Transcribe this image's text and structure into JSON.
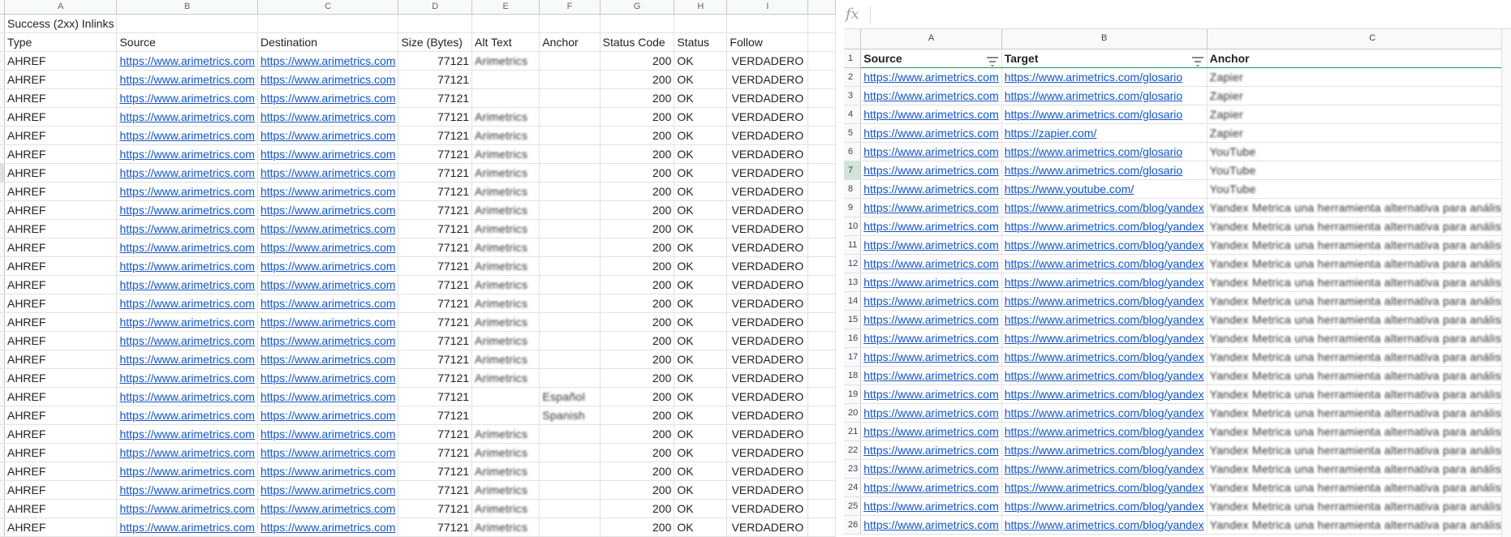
{
  "left": {
    "col_letters": [
      "A",
      "B",
      "C",
      "D",
      "E",
      "F",
      "G",
      "H",
      "I"
    ],
    "title": "Success (2xx) Inlinks",
    "headers": [
      "Type",
      "Source",
      "Destination",
      "Size (Bytes)",
      "Alt Text",
      "Anchor",
      "Status Code",
      "Status",
      "Follow"
    ],
    "rows": [
      [
        "AHREF",
        "https://www.arimetrics.com",
        "https://www.arimetrics.com",
        "77121",
        "Arimetrics",
        "",
        "200",
        "OK",
        "VERDADERO"
      ],
      [
        "AHREF",
        "https://www.arimetrics.com",
        "https://www.arimetrics.com",
        "77121",
        "",
        "",
        "200",
        "OK",
        "VERDADERO"
      ],
      [
        "AHREF",
        "https://www.arimetrics.com",
        "https://www.arimetrics.com",
        "77121",
        "",
        "",
        "200",
        "OK",
        "VERDADERO"
      ],
      [
        "AHREF",
        "https://www.arimetrics.com",
        "https://www.arimetrics.com",
        "77121",
        "Arimetrics",
        "",
        "200",
        "OK",
        "VERDADERO"
      ],
      [
        "AHREF",
        "https://www.arimetrics.com",
        "https://www.arimetrics.com",
        "77121",
        "Arimetrics",
        "",
        "200",
        "OK",
        "VERDADERO"
      ],
      [
        "AHREF",
        "https://www.arimetrics.com",
        "https://www.arimetrics.com",
        "77121",
        "Arimetrics",
        "",
        "200",
        "OK",
        "VERDADERO"
      ],
      [
        "AHREF",
        "https://www.arimetrics.com",
        "https://www.arimetrics.com",
        "77121",
        "Arimetrics",
        "",
        "200",
        "OK",
        "VERDADERO"
      ],
      [
        "AHREF",
        "https://www.arimetrics.com",
        "https://www.arimetrics.com",
        "77121",
        "Arimetrics",
        "",
        "200",
        "OK",
        "VERDADERO"
      ],
      [
        "AHREF",
        "https://www.arimetrics.com",
        "https://www.arimetrics.com",
        "77121",
        "Arimetrics",
        "",
        "200",
        "OK",
        "VERDADERO"
      ],
      [
        "AHREF",
        "https://www.arimetrics.com",
        "https://www.arimetrics.com",
        "77121",
        "Arimetrics",
        "",
        "200",
        "OK",
        "VERDADERO"
      ],
      [
        "AHREF",
        "https://www.arimetrics.com",
        "https://www.arimetrics.com",
        "77121",
        "Arimetrics",
        "",
        "200",
        "OK",
        "VERDADERO"
      ],
      [
        "AHREF",
        "https://www.arimetrics.com",
        "https://www.arimetrics.com",
        "77121",
        "Arimetrics",
        "",
        "200",
        "OK",
        "VERDADERO"
      ],
      [
        "AHREF",
        "https://www.arimetrics.com",
        "https://www.arimetrics.com",
        "77121",
        "Arimetrics",
        "",
        "200",
        "OK",
        "VERDADERO"
      ],
      [
        "AHREF",
        "https://www.arimetrics.com",
        "https://www.arimetrics.com",
        "77121",
        "Arimetrics",
        "",
        "200",
        "OK",
        "VERDADERO"
      ],
      [
        "AHREF",
        "https://www.arimetrics.com",
        "https://www.arimetrics.com",
        "77121",
        "Arimetrics",
        "",
        "200",
        "OK",
        "VERDADERO"
      ],
      [
        "AHREF",
        "https://www.arimetrics.com",
        "https://www.arimetrics.com",
        "77121",
        "Arimetrics",
        "",
        "200",
        "OK",
        "VERDADERO"
      ],
      [
        "AHREF",
        "https://www.arimetrics.com",
        "https://www.arimetrics.com",
        "77121",
        "Arimetrics",
        "",
        "200",
        "OK",
        "VERDADERO"
      ],
      [
        "AHREF",
        "https://www.arimetrics.com",
        "https://www.arimetrics.com",
        "77121",
        "Arimetrics",
        "",
        "200",
        "OK",
        "VERDADERO"
      ],
      [
        "AHREF",
        "https://www.arimetrics.com",
        "https://www.arimetrics.com",
        "77121",
        "",
        "Español",
        "200",
        "OK",
        "VERDADERO"
      ],
      [
        "AHREF",
        "https://www.arimetrics.com",
        "https://www.arimetrics.com",
        "77121",
        "",
        "Spanish",
        "200",
        "OK",
        "VERDADERO"
      ],
      [
        "AHREF",
        "https://www.arimetrics.com",
        "https://www.arimetrics.com",
        "77121",
        "Arimetrics",
        "",
        "200",
        "OK",
        "VERDADERO"
      ],
      [
        "AHREF",
        "https://www.arimetrics.com",
        "https://www.arimetrics.com",
        "77121",
        "Arimetrics",
        "",
        "200",
        "OK",
        "VERDADERO"
      ],
      [
        "AHREF",
        "https://www.arimetrics.com",
        "https://www.arimetrics.com",
        "77121",
        "Arimetrics",
        "",
        "200",
        "OK",
        "VERDADERO"
      ],
      [
        "AHREF",
        "https://www.arimetrics.com",
        "https://www.arimetrics.com",
        "77121",
        "Arimetrics",
        "",
        "200",
        "OK",
        "VERDADERO"
      ],
      [
        "AHREF",
        "https://www.arimetrics.com",
        "https://www.arimetrics.com",
        "77121",
        "Arimetrics",
        "",
        "200",
        "OK",
        "VERDADERO"
      ],
      [
        "AHREF",
        "https://www.arimetrics.com",
        "https://www.arimetrics.com",
        "77121",
        "Arimetrics",
        "",
        "200",
        "OK",
        "VERDADERO"
      ]
    ]
  },
  "right": {
    "fx_label": "fx",
    "col_letters": [
      "A",
      "B",
      "C"
    ],
    "headers": [
      "Source",
      "Target",
      "Anchor"
    ],
    "row_numbers": [
      "1",
      "2",
      "3",
      "4",
      "5",
      "6",
      "7",
      "8",
      "9",
      "10",
      "11",
      "12",
      "13",
      "14",
      "15",
      "16",
      "17",
      "18",
      "19",
      "20",
      "21",
      "22",
      "23",
      "24",
      "25",
      "26"
    ],
    "rows": [
      [
        "https://www.arimetrics.com",
        "https://www.arimetrics.com/glosario",
        "Zapier"
      ],
      [
        "https://www.arimetrics.com",
        "https://www.arimetrics.com/glosario",
        "Zapier"
      ],
      [
        "https://www.arimetrics.com",
        "https://www.arimetrics.com/glosario",
        "Zapier"
      ],
      [
        "https://www.arimetrics.com",
        "https://zapier.com/",
        "Zapier"
      ],
      [
        "https://www.arimetrics.com",
        "https://www.arimetrics.com/glosario",
        "YouTube"
      ],
      [
        "https://www.arimetrics.com",
        "https://www.arimetrics.com/glosario",
        "YouTube"
      ],
      [
        "https://www.arimetrics.com",
        "https://www.youtube.com/",
        "YouTube"
      ],
      [
        "https://www.arimetrics.com",
        "https://www.arimetrics.com/blog/yandex",
        "Yandex Metrica una herramienta alternativa para análisis web"
      ],
      [
        "https://www.arimetrics.com",
        "https://www.arimetrics.com/blog/yandex",
        "Yandex Metrica una herramienta alternativa para análisis web"
      ],
      [
        "https://www.arimetrics.com",
        "https://www.arimetrics.com/blog/yandex",
        "Yandex Metrica una herramienta alternativa para análisis web"
      ],
      [
        "https://www.arimetrics.com",
        "https://www.arimetrics.com/blog/yandex",
        "Yandex Metrica una herramienta alternativa para análisis web"
      ],
      [
        "https://www.arimetrics.com",
        "https://www.arimetrics.com/blog/yandex",
        "Yandex Metrica una herramienta alternativa para análisis web"
      ],
      [
        "https://www.arimetrics.com",
        "https://www.arimetrics.com/blog/yandex",
        "Yandex Metrica una herramienta alternativa para análisis web"
      ],
      [
        "https://www.arimetrics.com",
        "https://www.arimetrics.com/blog/yandex",
        "Yandex Metrica una herramienta alternativa para análisis web"
      ],
      [
        "https://www.arimetrics.com",
        "https://www.arimetrics.com/blog/yandex",
        "Yandex Metrica una herramienta alternativa para análisis web"
      ],
      [
        "https://www.arimetrics.com",
        "https://www.arimetrics.com/blog/yandex",
        "Yandex Metrica una herramienta alternativa para análisis web"
      ],
      [
        "https://www.arimetrics.com",
        "https://www.arimetrics.com/blog/yandex",
        "Yandex Metrica una herramienta alternativa para análisis web"
      ],
      [
        "https://www.arimetrics.com",
        "https://www.arimetrics.com/blog/yandex",
        "Yandex Metrica una herramienta alternativa para análisis web"
      ],
      [
        "https://www.arimetrics.com",
        "https://www.arimetrics.com/blog/yandex",
        "Yandex Metrica una herramienta alternativa para análisis web"
      ],
      [
        "https://www.arimetrics.com",
        "https://www.arimetrics.com/blog/yandex",
        "Yandex Metrica una herramienta alternativa para análisis web"
      ],
      [
        "https://www.arimetrics.com",
        "https://www.arimetrics.com/blog/yandex",
        "Yandex Metrica una herramienta alternativa para análisis web"
      ],
      [
        "https://www.arimetrics.com",
        "https://www.arimetrics.com/blog/yandex",
        "Yandex Metrica una herramienta alternativa para análisis web"
      ],
      [
        "https://www.arimetrics.com",
        "https://www.arimetrics.com/blog/yandex",
        "Yandex Metrica una herramienta alternativa para análisis web"
      ],
      [
        "https://www.arimetrics.com",
        "https://www.arimetrics.com/blog/yandex",
        "Yandex Metrica una herramienta alternativa para análisis web"
      ],
      [
        "https://www.arimetrics.com",
        "https://www.arimetrics.com/blog/yandex",
        "Yandex Metrica una herramienta alternativa para análisis web"
      ]
    ]
  },
  "colors": {
    "link": "#1155cc",
    "selection_green": "#0f9d58",
    "header_bg": "#f8f9fa"
  },
  "icons": {
    "filter": "filter-icon",
    "fx": "fx-icon"
  }
}
